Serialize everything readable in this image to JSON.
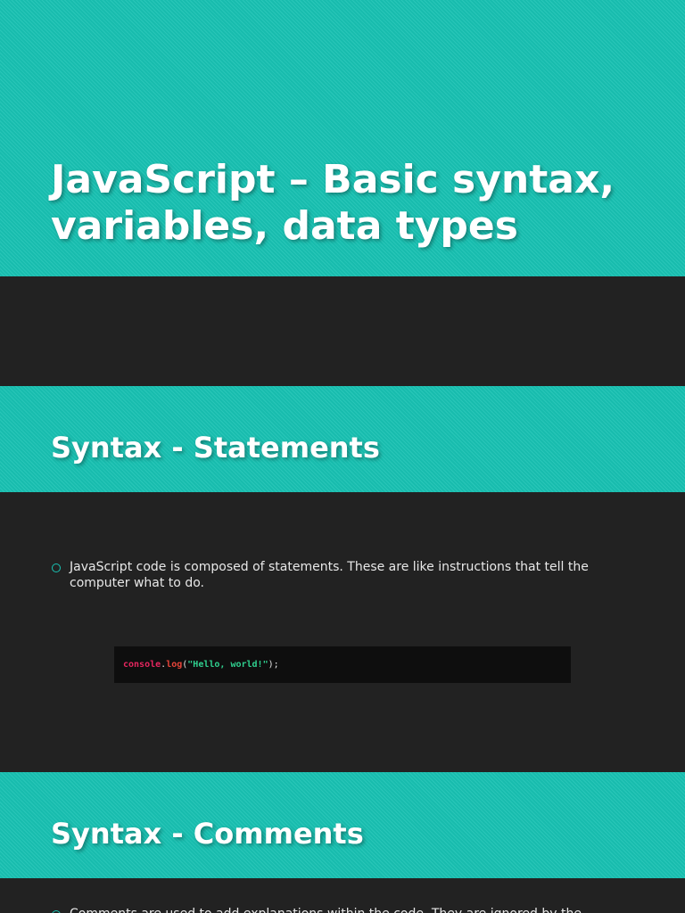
{
  "slides": [
    {
      "title": "JavaScript – Basic syntax, variables, data types"
    },
    {
      "title": "Syntax - Statements",
      "bullets": [
        "JavaScript code is composed of statements. These are like instructions that tell the computer what to do."
      ],
      "code": {
        "object": "console",
        "dot": ".",
        "method": "log",
        "open": "(",
        "string": "\"Hello, world!\"",
        "close": ");"
      }
    },
    {
      "title": "Syntax - Comments",
      "bullets": [
        "Comments are used to add explanations within the code. They are ignored by the"
      ]
    }
  ],
  "colors": {
    "accent": "#19c2b3",
    "background": "#222222",
    "code_background": "#0e0e0e",
    "code_object": "#e6265f",
    "code_method": "#e8453a",
    "code_string": "#2fcf8e"
  }
}
